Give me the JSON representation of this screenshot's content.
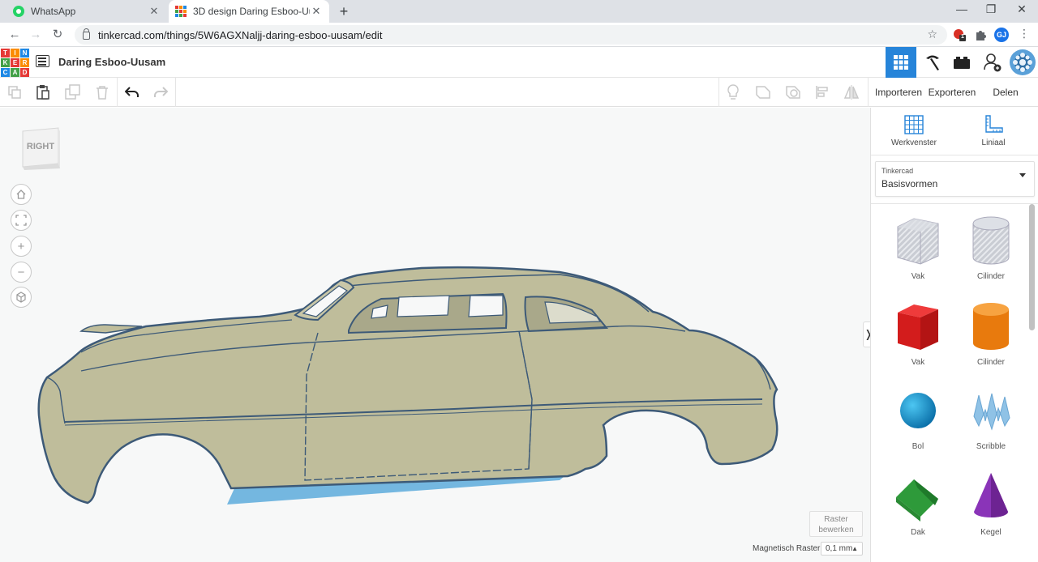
{
  "browser": {
    "tabs": [
      {
        "title": "WhatsApp",
        "active": false
      },
      {
        "title": "3D design Daring Esboo-Uusam",
        "active": true
      }
    ],
    "url": "tinkercad.com/things/5W6AGXNaljj-daring-esboo-uusam/edit",
    "profile_initials": "GJ",
    "extension_badge": "1"
  },
  "app": {
    "logo_letters": [
      "T",
      "I",
      "N",
      "K",
      "E",
      "R",
      "C",
      "A",
      "D"
    ],
    "design_title": "Daring Esboo-Uusam"
  },
  "toolbar": {
    "import_label": "Importeren",
    "export_label": "Exporteren",
    "share_label": "Delen"
  },
  "workplane": {
    "viewcube_face": "RIGHT",
    "snap_label": "Magnetisch Raster",
    "snap_value": "0,1 mm",
    "raster_button": [
      "Raster",
      "bewerken"
    ]
  },
  "panel": {
    "tools": [
      {
        "label": "Werkvenster",
        "icon": "grid-icon"
      },
      {
        "label": "Liniaal",
        "icon": "ruler-icon"
      }
    ],
    "library_group": "Tinkercad",
    "library_name": "Basisvormen",
    "shapes": [
      {
        "label": "Vak",
        "icon": "hole-box-icon"
      },
      {
        "label": "Cilinder",
        "icon": "hole-cylinder-icon"
      },
      {
        "label": "Vak",
        "icon": "box-icon"
      },
      {
        "label": "Cilinder",
        "icon": "cylinder-icon"
      },
      {
        "label": "Bol",
        "icon": "sphere-icon"
      },
      {
        "label": "Scribble",
        "icon": "scribble-icon"
      },
      {
        "label": "Dak",
        "icon": "roof-icon"
      },
      {
        "label": "Kegel",
        "icon": "cone-icon"
      }
    ]
  },
  "colors": {
    "accent": "#2684d9",
    "car_body": "#bfbd9b",
    "car_outline": "#3d5a78",
    "selection_shadow": "#74b7e0"
  }
}
